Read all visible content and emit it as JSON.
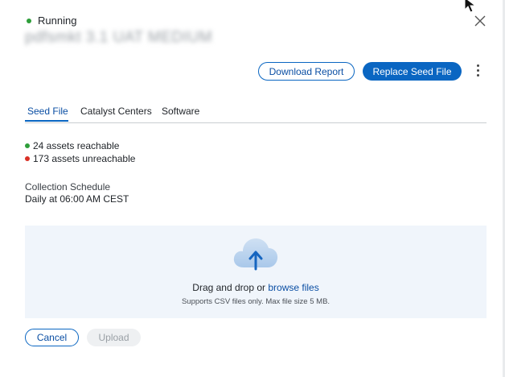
{
  "status": {
    "label": "Running",
    "color": "#2e9e3a"
  },
  "header": {
    "title": "pdfsmkt 3.1 UAT MEDIUM",
    "download_report": "Download Report",
    "replace_seed_file": "Replace Seed File",
    "close_icon": "close-icon",
    "more_icon": "kebab-menu-icon"
  },
  "tabs": [
    {
      "label": "Seed File",
      "active": true
    },
    {
      "label": "Catalyst Centers",
      "active": false
    },
    {
      "label": "Software",
      "active": false
    }
  ],
  "summary": {
    "reachable": {
      "text": "24 assets reachable",
      "color": "#2e9e3a"
    },
    "unreachable": {
      "text": "173 assets unreachable",
      "color": "#d93025"
    }
  },
  "schedule": {
    "label": "Collection Schedule",
    "value": "Daily at 06:00 AM CEST"
  },
  "dropzone": {
    "icon": "cloud-upload-icon",
    "text_prefix": "Drag and drop or",
    "browse_link": "browse files",
    "subtext": "Supports CSV files only. Max file size 5 MB."
  },
  "footer": {
    "cancel": "Cancel",
    "upload": "Upload"
  },
  "colors": {
    "accent": "#0a66c2",
    "dropzone_bg": "#f0f5fb"
  }
}
